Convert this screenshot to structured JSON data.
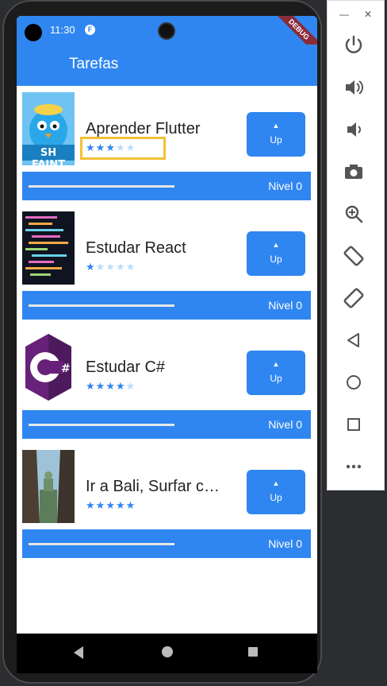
{
  "status": {
    "time": "11:30",
    "debug_label": "DEBUG"
  },
  "appbar": {
    "title": "Tarefas"
  },
  "tasks": [
    {
      "name": "Aprender Flutter",
      "stars": [
        "★",
        "★",
        "★",
        "★",
        "★"
      ],
      "difficulty": 3,
      "up_label": "Up",
      "level_text": "Nivel 0",
      "progress": 0,
      "thumb_caption": "SH FAINT"
    },
    {
      "name": "Estudar React",
      "stars": [
        "★",
        "★",
        "★",
        "★",
        "★"
      ],
      "difficulty": 1,
      "up_label": "Up",
      "level_text": "Nivel 0",
      "progress": 0
    },
    {
      "name": "Estudar C#",
      "stars": [
        "★",
        "★",
        "★",
        "★",
        "★"
      ],
      "difficulty": 4,
      "up_label": "Up",
      "level_text": "Nivel 0",
      "progress": 0
    },
    {
      "name": "Ir a Bali, Surfar com os amigos",
      "stars": [
        "★",
        "★",
        "★",
        "★",
        "★"
      ],
      "difficulty": 5,
      "up_label": "Up",
      "level_text": "Nivel 0",
      "progress": 0
    }
  ],
  "emulator": {
    "min_label": "—",
    "close_label": "✕"
  },
  "colors": {
    "primary": "#2f86f0",
    "star_off": "#bcdcf8",
    "highlight": "#f2c037"
  }
}
